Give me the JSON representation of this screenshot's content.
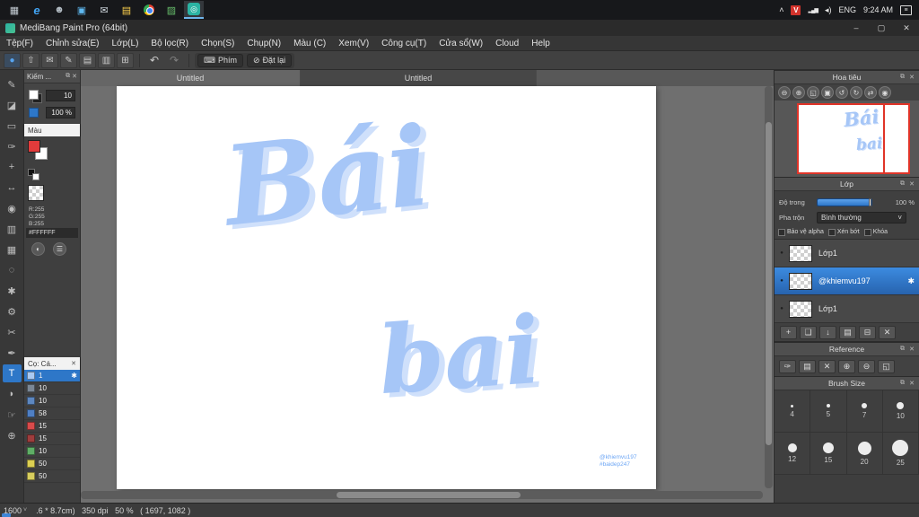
{
  "taskbar": {
    "icons": [
      {
        "label": "task-view",
        "glyph": "▦",
        "color": "#c5cdd4"
      },
      {
        "label": "edge",
        "glyph": "e",
        "color": "#42a5f5"
      },
      {
        "label": "people",
        "glyph": "☻",
        "color": "#b5bec6"
      },
      {
        "label": "store",
        "glyph": "▣",
        "color": "#5fb8f0"
      },
      {
        "label": "mail",
        "glyph": "✉",
        "color": "#cdd5db"
      },
      {
        "label": "explorer",
        "glyph": "▤",
        "color": "#ffd24d"
      },
      {
        "label": "chrome",
        "glyph": "",
        "color": ""
      },
      {
        "label": "photos",
        "glyph": "▨",
        "color": "#66bb6a"
      },
      {
        "label": "medibang",
        "glyph": "◎",
        "color": "#ffffff"
      }
    ],
    "tray": {
      "chevron": "˄",
      "v_badge": "V",
      "network": "▂▄▆",
      "volume": "◂)",
      "lang": "ENG",
      "time": "9:24 AM",
      "notification": "≡"
    }
  },
  "titlebar": {
    "title": "MediBang Paint Pro (64bit)",
    "minimize": "–",
    "maximize": "▢",
    "close": "✕"
  },
  "menubar": {
    "items": [
      "Tệp(F)",
      "Chỉnh sửa(E)",
      "Lớp(L)",
      "Bộ lọc(R)",
      "Chọn(S)",
      "Chụp(N)",
      "Màu (C)",
      "Xem(V)",
      "Công cụ(T)",
      "Cửa sổ(W)",
      "Cloud",
      "Help"
    ]
  },
  "toolbar": {
    "icons": [
      {
        "label": "brush-color",
        "glyph": "●"
      },
      {
        "label": "export",
        "glyph": "⇧"
      },
      {
        "label": "comment",
        "glyph": "✉"
      },
      {
        "label": "pen-settings",
        "glyph": "✎"
      },
      {
        "label": "panels-a",
        "glyph": "▤"
      },
      {
        "label": "panels-b",
        "glyph": "▥"
      },
      {
        "label": "grid",
        "glyph": "⊞"
      }
    ],
    "undo": "↶",
    "redo": "↷",
    "phim_icon": "⌨",
    "phim_label": "Phím",
    "reset_icon": "⊘",
    "reset_label": "Đặt lại"
  },
  "tabs": {
    "items": [
      {
        "label": "Untitled"
      },
      {
        "label": "Untitled"
      }
    ]
  },
  "tools": [
    {
      "label": "pen",
      "glyph": "✎"
    },
    {
      "label": "eraser",
      "glyph": "◪"
    },
    {
      "label": "marquee",
      "glyph": "▭"
    },
    {
      "label": "brush",
      "glyph": "✑"
    },
    {
      "label": "move",
      "glyph": "+"
    },
    {
      "label": "transform",
      "glyph": "↔"
    },
    {
      "label": "fill",
      "glyph": "◉"
    },
    {
      "label": "gradient",
      "glyph": "▥"
    },
    {
      "label": "select",
      "glyph": "▦"
    },
    {
      "label": "lasso",
      "glyph": "◌"
    },
    {
      "label": "wand",
      "glyph": "✱"
    },
    {
      "label": "operation",
      "glyph": "⚙"
    },
    {
      "label": "divide",
      "glyph": "✂"
    },
    {
      "label": "pen2",
      "glyph": "✒"
    },
    {
      "label": "text",
      "glyph": "T"
    },
    {
      "label": "eyedropper",
      "glyph": "◗"
    },
    {
      "label": "hand",
      "glyph": "☞"
    },
    {
      "label": "zoom",
      "glyph": "⊕"
    }
  ],
  "left_panel": {
    "title": "Kiếm ...",
    "popout": "⧉",
    "close": "✕",
    "size_value": "10",
    "opacity_value": "100 %",
    "color": {
      "title": "Màu",
      "r": "R:255",
      "g": "G:255",
      "b": "B:255",
      "hex": "#FFFFFF",
      "wheel_icon": "◐",
      "slider_icon": "☰"
    },
    "brush": {
      "title": "Cọ: Cá...",
      "close": "✕",
      "star": "✱",
      "rows": [
        {
          "num": "1",
          "chip": "#a9c9f2",
          "selected": true
        },
        {
          "num": "10",
          "chip": "#7b8795"
        },
        {
          "num": "10",
          "chip": "#5d87c0"
        },
        {
          "num": "58",
          "chip": "#4f7fc4"
        },
        {
          "num": "15",
          "chip": "#d94b4b"
        },
        {
          "num": "15",
          "chip": "#9e3d3d"
        },
        {
          "num": "10",
          "chip": "#5fae66"
        },
        {
          "num": "50",
          "chip": "#dccf52"
        },
        {
          "num": "50",
          "chip": "#d8ce5e"
        }
      ]
    }
  },
  "canvas": {
    "word_top": "Bái",
    "word_bottom": "bai",
    "watermark1": "@khiemvu197",
    "watermark2": "#baidep247"
  },
  "navigator": {
    "title": "Hoa tiêu",
    "popout": "⧉",
    "close": "✕",
    "buttons": [
      {
        "label": "zoom-out",
        "glyph": "⊖"
      },
      {
        "label": "zoom-in",
        "glyph": "⊕"
      },
      {
        "label": "fit",
        "glyph": "◱"
      },
      {
        "label": "actual-size",
        "glyph": "▣"
      },
      {
        "label": "rotate-ccw",
        "glyph": "↺"
      },
      {
        "label": "rotate-cw",
        "glyph": "↻"
      },
      {
        "label": "flip",
        "glyph": "⇄"
      },
      {
        "label": "reset-view",
        "glyph": "◉"
      }
    ],
    "mini_top": "Bái",
    "mini_bottom": "bai"
  },
  "layers": {
    "title": "Lớp",
    "popout": "⧉",
    "close": "✕",
    "opacity_label": "Độ trong",
    "opacity_value": "100 %",
    "blend_label": "Pha trộn",
    "blend_value": "Bình thường",
    "blend_caret": "˅",
    "check_alpha": "Bảo vệ alpha",
    "check_clip": "Xén bớt",
    "check_lock": "Khóa",
    "eye": "●",
    "gear": "✱",
    "rows": [
      {
        "label": "Lớp1"
      },
      {
        "label": "@khiemvu197",
        "selected": true
      },
      {
        "label": "Lớp1"
      }
    ],
    "buttons": [
      {
        "label": "new-layer",
        "glyph": "+"
      },
      {
        "label": "duplicate-layer",
        "glyph": "❏"
      },
      {
        "label": "merge-down",
        "glyph": "↓"
      },
      {
        "label": "new-folder",
        "glyph": "▤"
      },
      {
        "label": "clear-layer",
        "glyph": "⊟"
      },
      {
        "label": "delete-layer",
        "glyph": "✕"
      }
    ]
  },
  "reference": {
    "title": "Reference",
    "popout": "⧉",
    "close": "✕",
    "buttons": [
      {
        "label": "pick",
        "glyph": "✑"
      },
      {
        "label": "open-folder",
        "glyph": "▤"
      },
      {
        "label": "clear",
        "glyph": "✕"
      },
      {
        "label": "zoom-in",
        "glyph": "⊕"
      },
      {
        "label": "zoom-out",
        "glyph": "⊖"
      },
      {
        "label": "fit",
        "glyph": "◱"
      }
    ]
  },
  "brush_size": {
    "title": "Brush Size",
    "popout": "⧉",
    "close": "✕",
    "cells": [
      {
        "label": "4",
        "dot": 3
      },
      {
        "label": "5",
        "dot": 4
      },
      {
        "label": "7",
        "dot": 6
      },
      {
        "label": "10",
        "dot": 8
      },
      {
        "label": "12",
        "dot": 10
      },
      {
        "label": "15",
        "dot": 12
      },
      {
        "label": "20",
        "dot": 15
      },
      {
        "label": "25",
        "dot": 18
      }
    ]
  },
  "statusbar": {
    "zoom": "1600",
    "caret": "˅",
    "info": ".6 * 8.7cm)   350 dpi   50 %   ( 1697, 1082 )"
  },
  "colors": {
    "accent": "#2e77c8",
    "canvas_text": "#a6c6f7",
    "selection_red": "#e03428"
  }
}
